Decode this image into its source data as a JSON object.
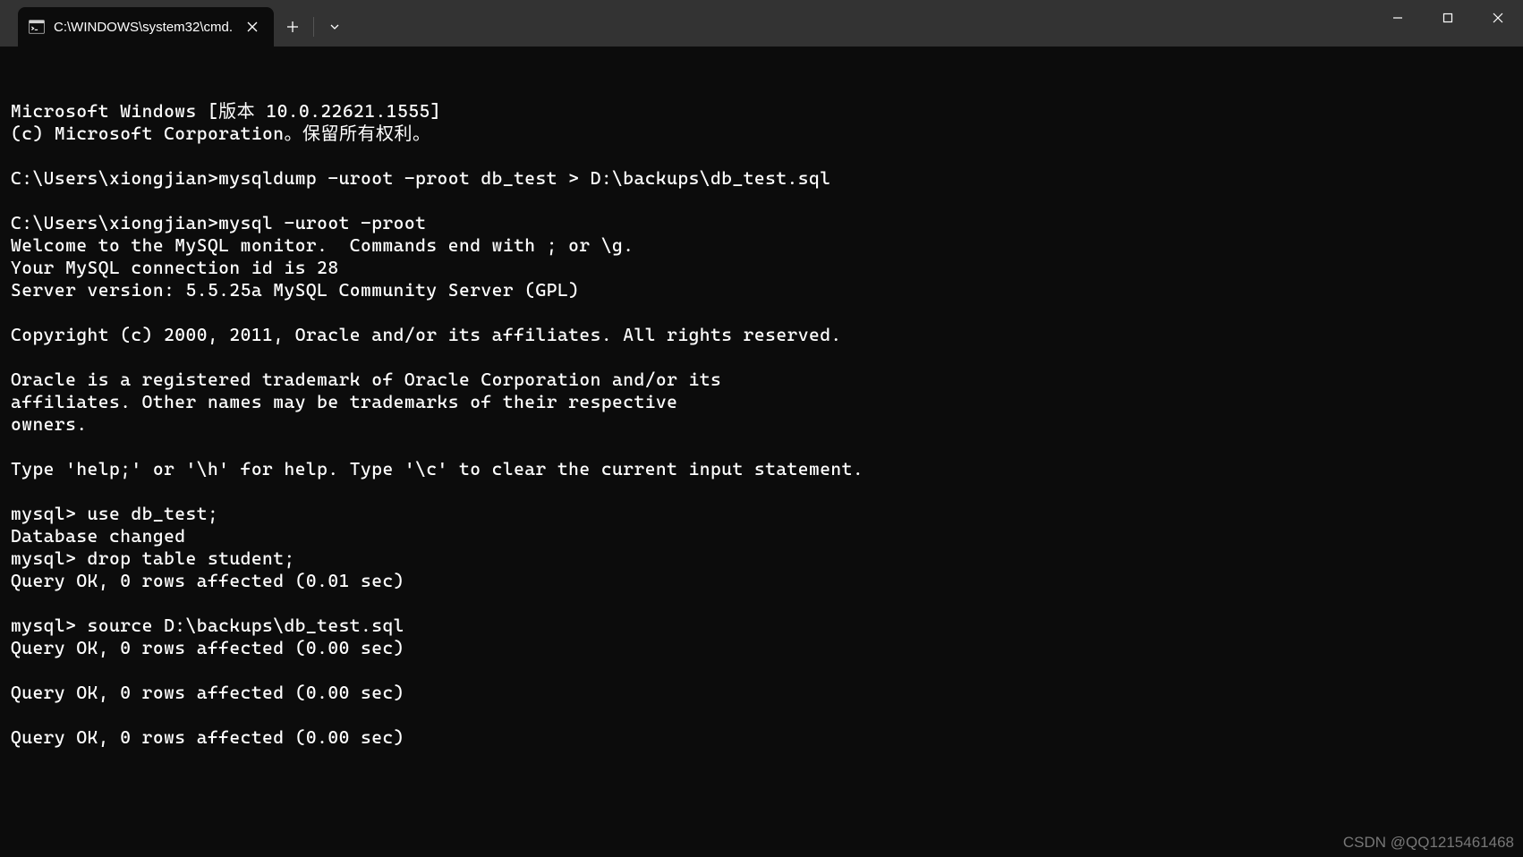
{
  "window": {
    "tab_title": "C:\\WINDOWS\\system32\\cmd.",
    "new_tab_tooltip": "+",
    "dropdown_tooltip": "⌄"
  },
  "terminal": {
    "lines": [
      "Microsoft Windows [版本 10.0.22621.1555]",
      "(c) Microsoft Corporation。保留所有权利。",
      "",
      "C:\\Users\\xiongjian>mysqldump -uroot -proot db_test > D:\\backups\\db_test.sql",
      "",
      "C:\\Users\\xiongjian>mysql -uroot -proot",
      "Welcome to the MySQL monitor.  Commands end with ; or \\g.",
      "Your MySQL connection id is 28",
      "Server version: 5.5.25a MySQL Community Server (GPL)",
      "",
      "Copyright (c) 2000, 2011, Oracle and/or its affiliates. All rights reserved.",
      "",
      "Oracle is a registered trademark of Oracle Corporation and/or its",
      "affiliates. Other names may be trademarks of their respective",
      "owners.",
      "",
      "Type 'help;' or '\\h' for help. Type '\\c' to clear the current input statement.",
      "",
      "mysql> use db_test;",
      "Database changed",
      "mysql> drop table student;",
      "Query OK, 0 rows affected (0.01 sec)",
      "",
      "mysql> source D:\\backups\\db_test.sql",
      "Query OK, 0 rows affected (0.00 sec)",
      "",
      "Query OK, 0 rows affected (0.00 sec)",
      "",
      "Query OK, 0 rows affected (0.00 sec)"
    ]
  },
  "watermark": "CSDN @QQ1215461468"
}
